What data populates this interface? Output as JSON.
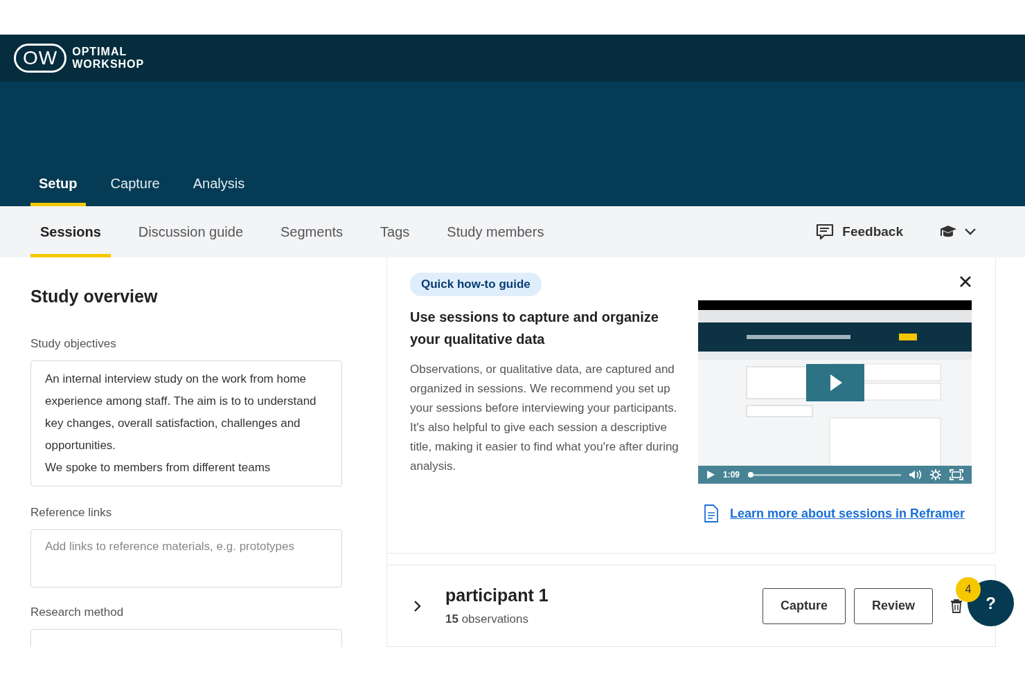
{
  "brand": {
    "mark": "OW",
    "name_lines": [
      "OPTIMAL",
      "WORKSHOP"
    ]
  },
  "main_tabs": [
    {
      "label": "Setup",
      "selected": true
    },
    {
      "label": "Capture",
      "selected": false
    },
    {
      "label": "Analysis",
      "selected": false
    }
  ],
  "sub_tabs": [
    {
      "label": "Sessions",
      "selected": true
    },
    {
      "label": "Discussion guide",
      "selected": false
    },
    {
      "label": "Segments",
      "selected": false
    },
    {
      "label": "Tags",
      "selected": false
    },
    {
      "label": "Study members",
      "selected": false
    }
  ],
  "feedback": {
    "label": "Feedback"
  },
  "study_overview": {
    "title": "Study overview",
    "fields": [
      {
        "kind": "text",
        "label": "Study objectives",
        "paragraphs": [
          "An internal interview study on the work from home experience among staff. The aim is to to understand key changes, overall satisfaction, challenges and opportunities.",
          "We spoke to members from different teams"
        ]
      },
      {
        "kind": "input",
        "label": "Reference links",
        "placeholder": "Add links to reference materials, e.g. prototypes"
      },
      {
        "kind": "select",
        "label": "Research method"
      }
    ]
  },
  "guide": {
    "badge": "Quick how-to guide",
    "heading": "Use sessions to capture and organize your qualitative data",
    "body": "Observations, or qualitative data, are captured and organized in sessions. We recommend you set up your sessions before interviewing your participants. It's also helpful to give each session a descriptive title, making it easier to find what you're after during analysis.",
    "video": {
      "kind": "picture",
      "time": "1:09",
      "level": 0.01
    },
    "link": "Learn more about sessions in Reframer"
  },
  "sessions": [
    {
      "title": "participant 1",
      "count": "15",
      "count_label": "observations",
      "buttons": [
        "Capture",
        "Review"
      ]
    }
  ],
  "help": {
    "label": "?",
    "badge": "4"
  }
}
